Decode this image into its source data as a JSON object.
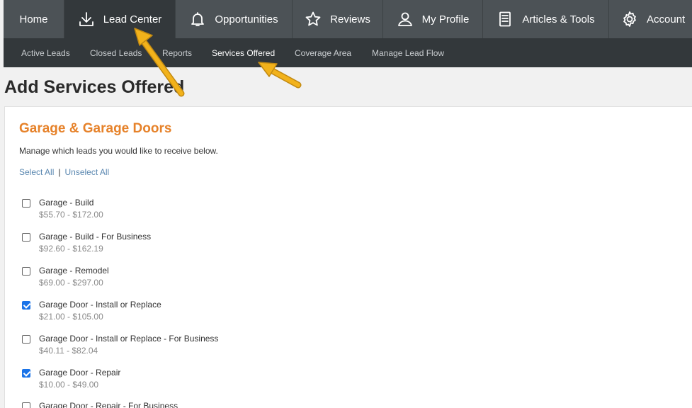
{
  "topnav": {
    "items": [
      {
        "label": "Home",
        "icon": ""
      },
      {
        "label": "Lead Center",
        "icon": "download-icon"
      },
      {
        "label": "Opportunities",
        "icon": "bell-icon"
      },
      {
        "label": "Reviews",
        "icon": "star-icon"
      },
      {
        "label": "My Profile",
        "icon": "user-icon"
      },
      {
        "label": "Articles & Tools",
        "icon": "document-icon"
      },
      {
        "label": "Account",
        "icon": "gear-icon"
      }
    ],
    "active": "Lead Center"
  },
  "subnav": {
    "items": [
      "Active Leads",
      "Closed Leads",
      "Reports",
      "Services Offered",
      "Coverage Area",
      "Manage Lead Flow"
    ],
    "active": "Services Offered"
  },
  "page": {
    "title": "Add Services Offered"
  },
  "section": {
    "title": "Garage & Garage Doors",
    "description": "Manage which leads you would like to receive below.",
    "select_all": "Select All",
    "separator": "|",
    "unselect_all": "Unselect All"
  },
  "services": [
    {
      "name": "Garage - Build",
      "price": "$55.70 - $172.00",
      "checked": false
    },
    {
      "name": "Garage - Build - For Business",
      "price": "$92.60 - $162.19",
      "checked": false
    },
    {
      "name": "Garage - Remodel",
      "price": "$69.00 - $297.00",
      "checked": false
    },
    {
      "name": "Garage Door - Install or Replace",
      "price": "$21.00 - $105.00",
      "checked": true
    },
    {
      "name": "Garage Door - Install or Replace - For Business",
      "price": "$40.11 - $82.04",
      "checked": false
    },
    {
      "name": "Garage Door - Repair",
      "price": "$10.00 - $49.00",
      "checked": true
    },
    {
      "name": "Garage Door - Repair - For Business",
      "price": "",
      "checked": false
    }
  ],
  "colors": {
    "nav_bg": "#4c5256",
    "nav_active": "#33383b",
    "accent": "#e6822a",
    "link": "#5a87b0",
    "check": "#1a73e8",
    "annotation_arrow": "#f2b21b"
  }
}
